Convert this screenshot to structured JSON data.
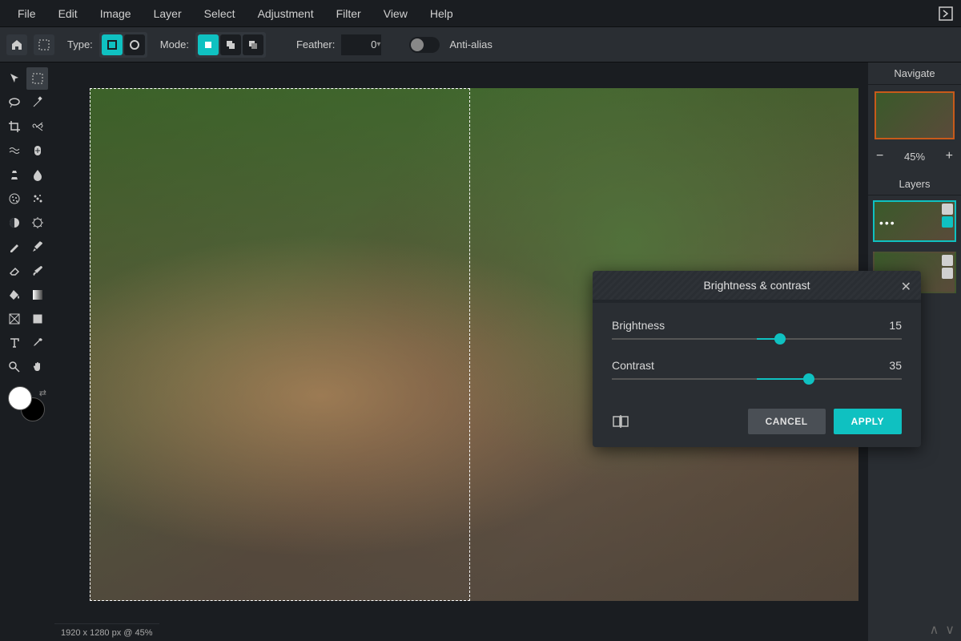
{
  "menubar": {
    "items": [
      "File",
      "Edit",
      "Image",
      "Layer",
      "Select",
      "Adjustment",
      "Filter",
      "View",
      "Help"
    ]
  },
  "optionsbar": {
    "type_label": "Type:",
    "mode_label": "Mode:",
    "feather_label": "Feather:",
    "feather_value": "0",
    "antialias_label": "Anti-alias"
  },
  "navigate": {
    "title": "Navigate",
    "zoom": "45%"
  },
  "layers": {
    "title": "Layers"
  },
  "dialog": {
    "title": "Brightness & contrast",
    "brightness_label": "Brightness",
    "brightness_value": "15",
    "contrast_label": "Contrast",
    "contrast_value": "35",
    "cancel": "CANCEL",
    "apply": "APPLY"
  },
  "status": {
    "text": "1920 x 1280 px @ 45%"
  }
}
